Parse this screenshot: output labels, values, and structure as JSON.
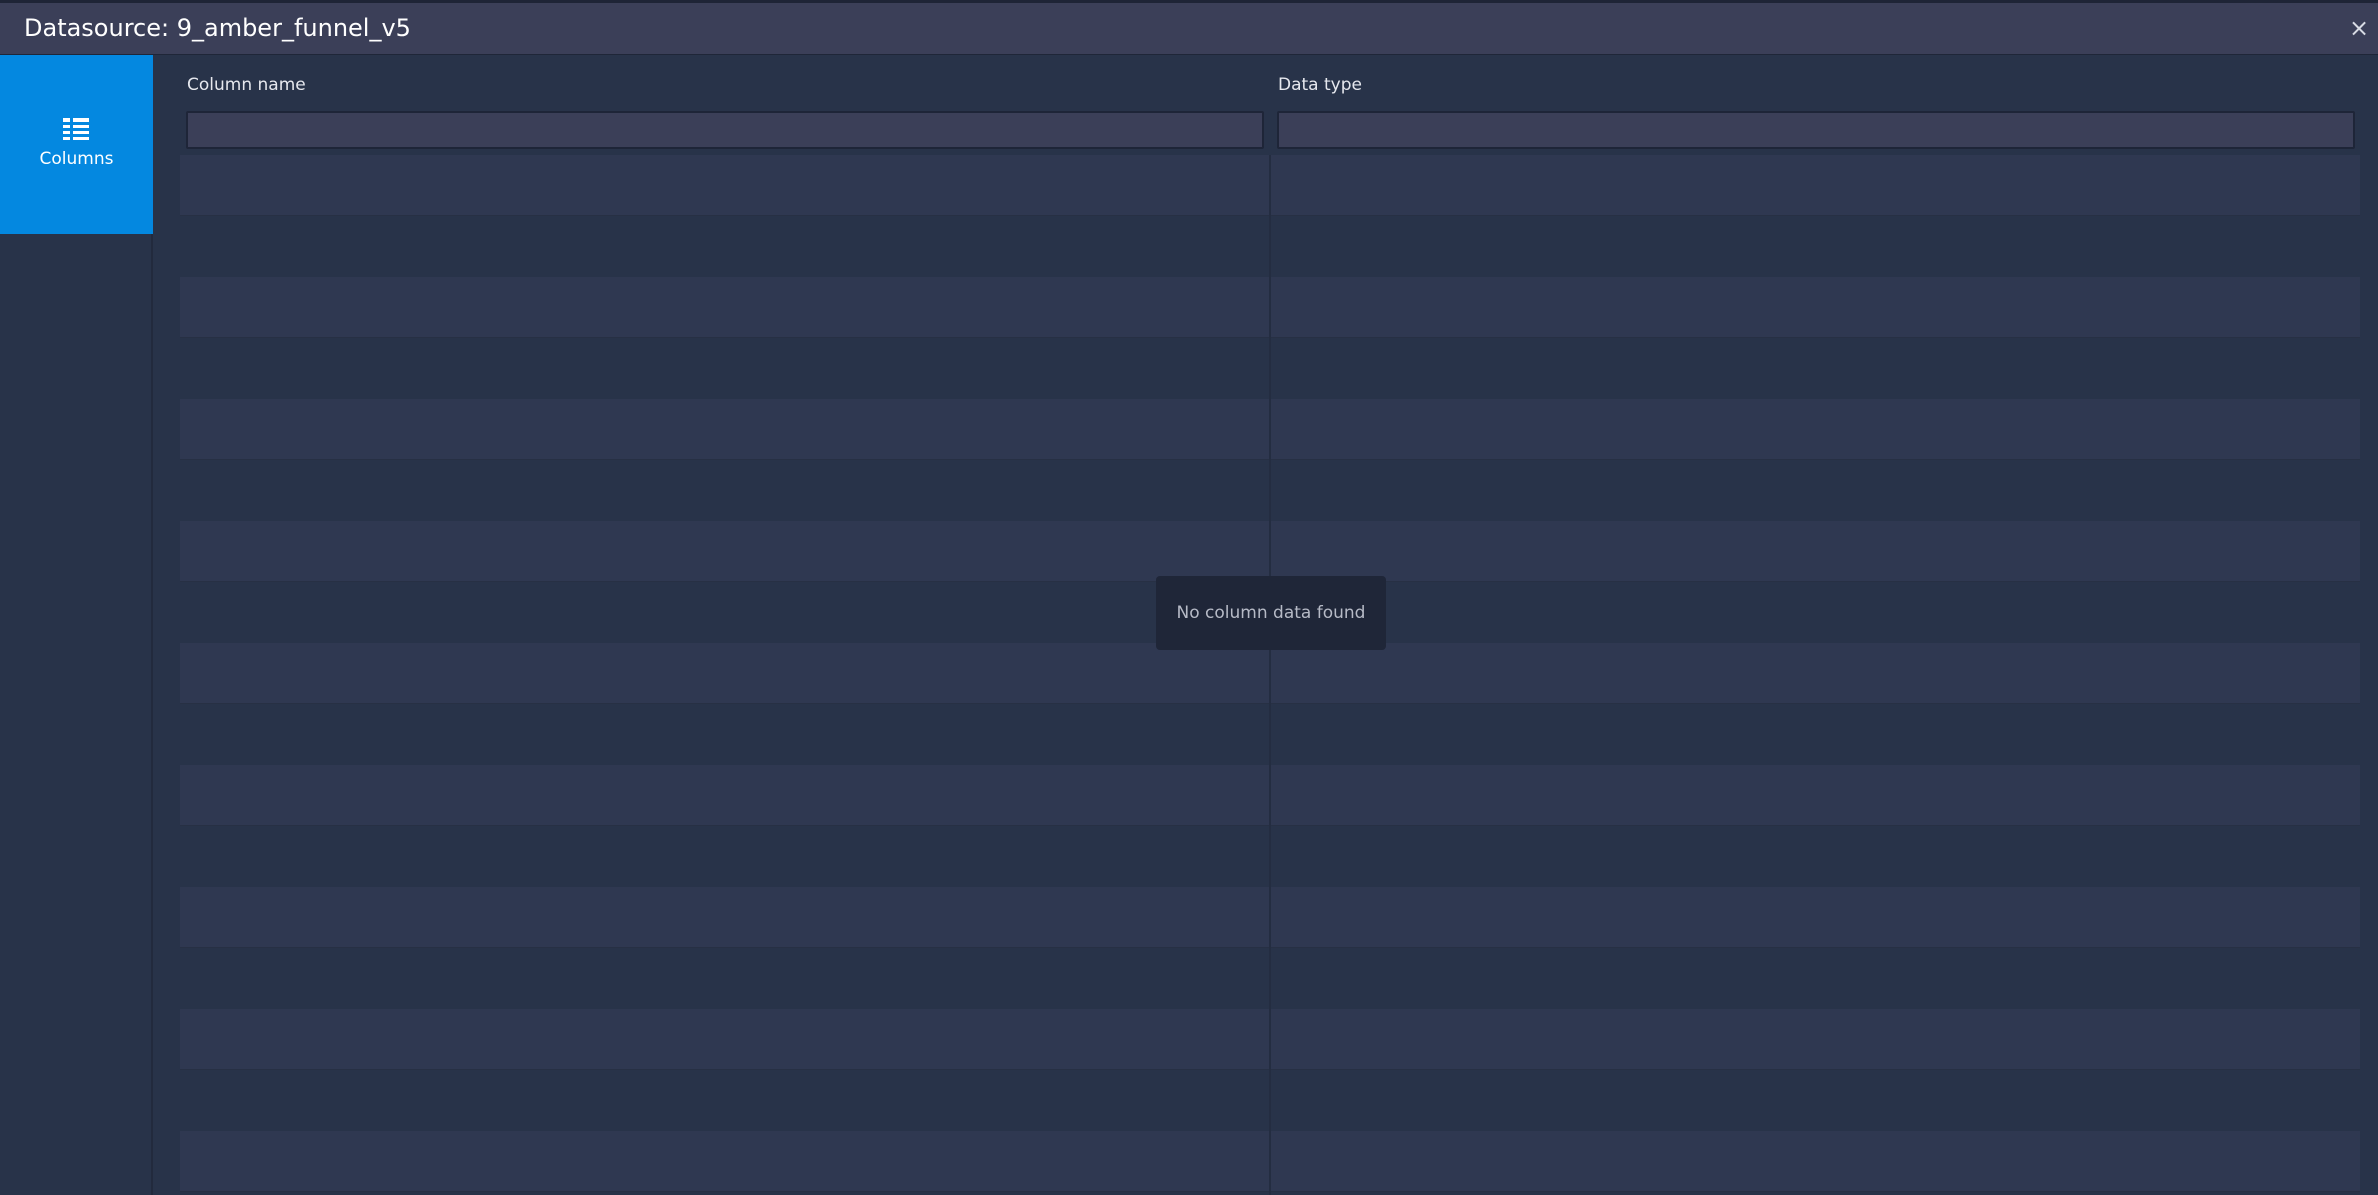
{
  "window": {
    "title": "Datasource: 9_amber_funnel_v5",
    "close_label": "×"
  },
  "sidebar": {
    "items": [
      {
        "label": "Columns",
        "icon": "columns-icon",
        "active": true
      }
    ],
    "active_color": "#0488e0"
  },
  "table": {
    "headers": [
      "Column name",
      "Data type"
    ],
    "filters": [
      {
        "value": "",
        "placeholder": ""
      },
      {
        "value": "",
        "placeholder": ""
      }
    ],
    "rows": [],
    "empty_message": "No column data found"
  }
}
